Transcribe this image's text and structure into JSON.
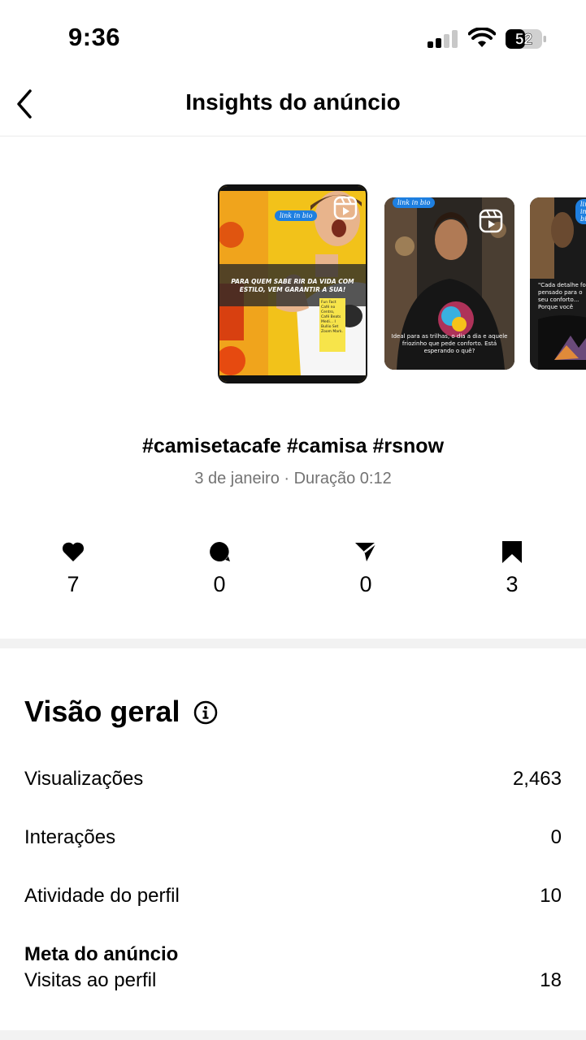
{
  "status_bar": {
    "time": "9:36",
    "battery_level": "52",
    "battery_pct": 52
  },
  "nav": {
    "title": "Insights do anúncio"
  },
  "thumbnails": {
    "t1": {
      "link_tag": "link in bio",
      "banner": "PARA QUEM SABE RIR DA VIDA COM ESTILO, VEM GARANTIR A SUA!",
      "note": "Fun Fact Café no Centro, Café Beats Medi... I Bullio Set Zoom Mark."
    },
    "t2": {
      "link_tag": "link in bio",
      "caption": "Ideal para as trilhas, o dia a dia e aquele friozinho que pede conforto. Está esperando o quê?"
    },
    "t3": {
      "link_tag": "link in bio",
      "caption": "\"Cada detalhe foi pensado para o seu conforto... Porque você"
    }
  },
  "ad": {
    "caption": "#camisetacafe #camisa #rsnow",
    "meta": "3 de janeiro · Duração 0:12"
  },
  "engagement": {
    "likes": "7",
    "comments": "0",
    "shares": "0",
    "saves": "3"
  },
  "overview": {
    "title": "Visão geral",
    "rows": [
      {
        "label": "Visualizações",
        "value": "2,463"
      },
      {
        "label": "Interações",
        "value": "0"
      },
      {
        "label": "Atividade do perfil",
        "value": "10"
      }
    ],
    "ad_goal": {
      "heading": "Meta do anúncio",
      "label": "Visitas ao perfil",
      "value": "18"
    }
  },
  "colors": {
    "muted_text": "#737373",
    "divider": "#f2f2f2",
    "link_blue": "#1e7fe0"
  }
}
